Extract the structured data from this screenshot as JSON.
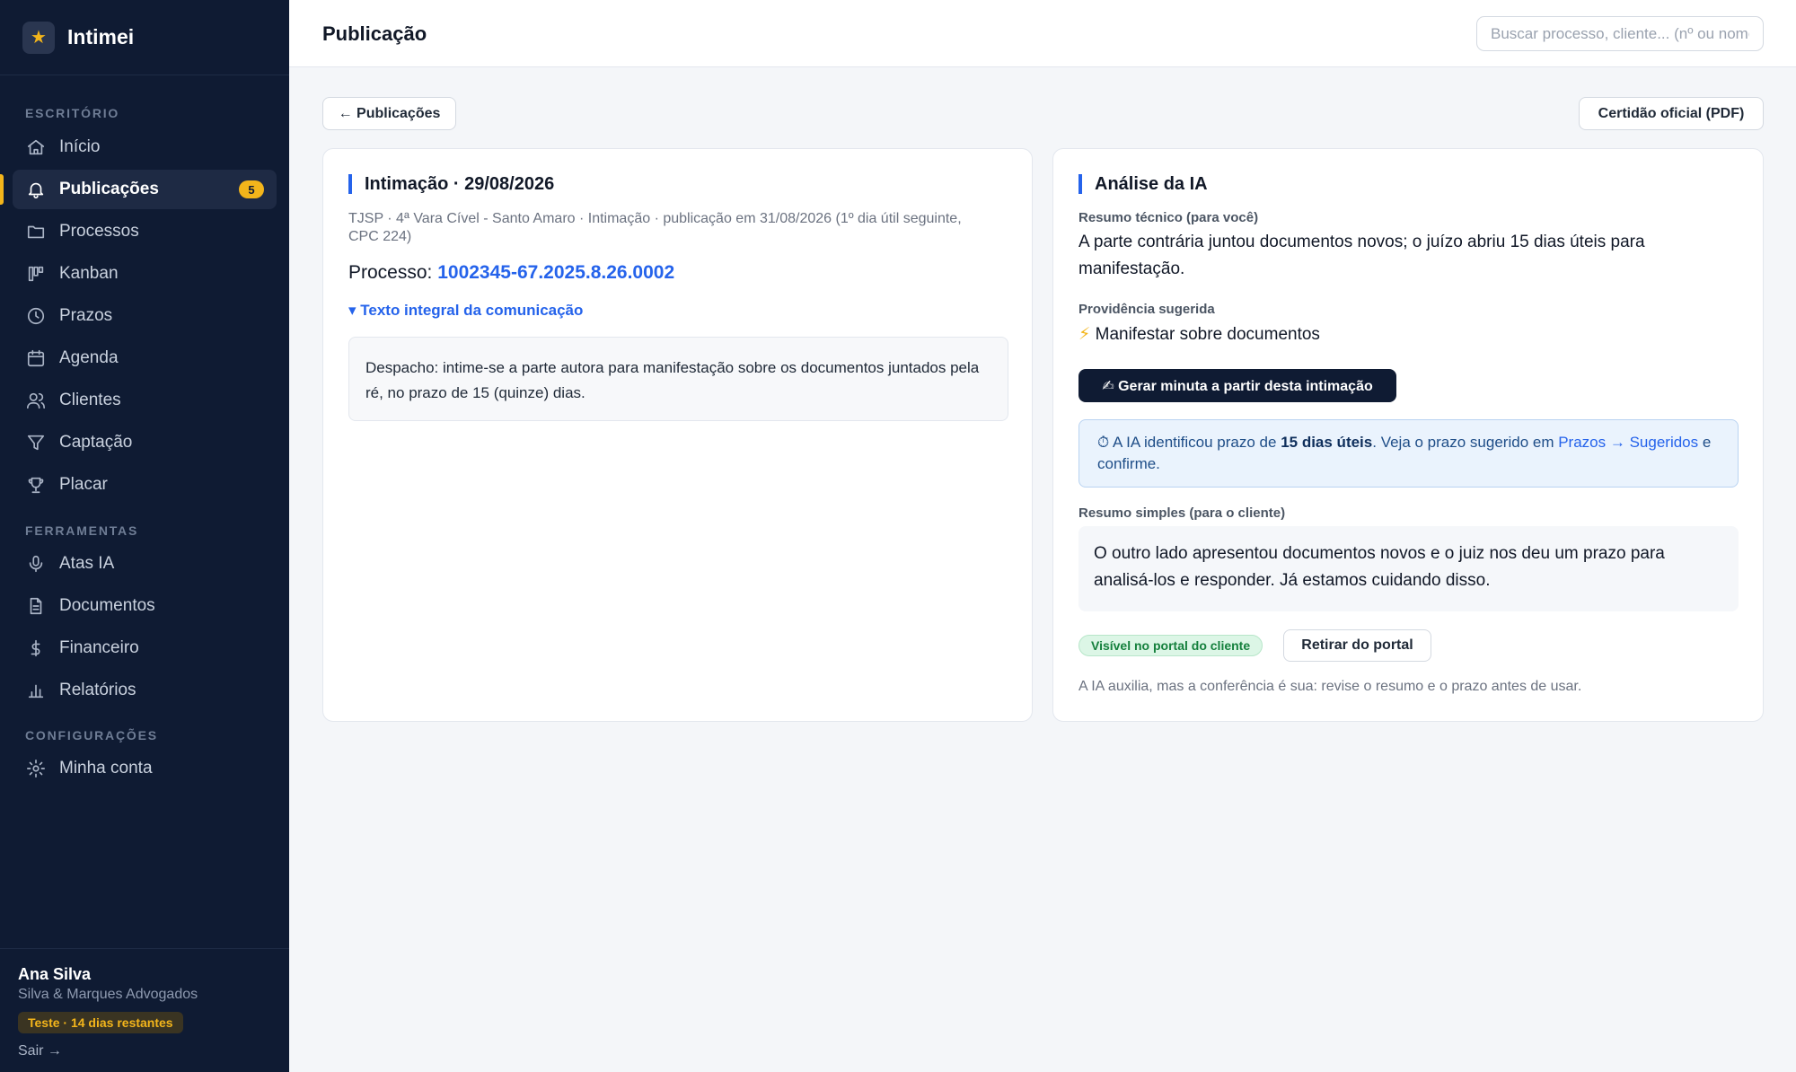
{
  "brand": {
    "logo_glyph": "★",
    "name": "Intimei",
    "accent": "#f3b51b"
  },
  "sidebar": {
    "sections": [
      "ESCRITÓRIO",
      "FERRAMENTAS",
      "CONFIGURAÇÕES"
    ],
    "items": [
      {
        "label": "Início",
        "icon": "home-icon"
      },
      {
        "label": "Publicações",
        "icon": "bell-icon",
        "badge": "5",
        "active": true
      },
      {
        "label": "Processos",
        "icon": "folder-icon"
      },
      {
        "label": "Kanban",
        "icon": "kanban-icon"
      },
      {
        "label": "Prazos",
        "icon": "clock-icon"
      },
      {
        "label": "Agenda",
        "icon": "calendar-icon"
      },
      {
        "label": "Clientes",
        "icon": "users-icon"
      },
      {
        "label": "Captação",
        "icon": "filter-icon"
      },
      {
        "label": "Placar",
        "icon": "trophy-icon"
      },
      {
        "label": "Atas IA",
        "icon": "microphone-icon"
      },
      {
        "label": "Documentos",
        "icon": "document-icon"
      },
      {
        "label": "Financeiro",
        "icon": "dollar-icon"
      },
      {
        "label": "Relatórios",
        "icon": "bar-chart-icon"
      },
      {
        "label": "Minha conta",
        "icon": "gear-icon"
      }
    ],
    "user": {
      "name": "Ana Silva",
      "firm": "Silva & Marques Advogados",
      "trial": "Teste · 14 dias restantes",
      "logout": "Sair →"
    }
  },
  "header": {
    "title": "Publicação",
    "search_placeholder": "Buscar processo, cliente... (nº ou nome)"
  },
  "actions": {
    "back": "← Publicações",
    "certificate": "Certidão oficial (PDF)"
  },
  "publication": {
    "title": "Intimação · 29/08/2026",
    "meta": "TJSP · 4ª Vara Cível - Santo Amaro · Intimação · publicação em 31/08/2026 (1º dia útil seguinte, CPC 224)",
    "process_label": "Processo: ",
    "process_number": "1002345-67.2025.8.26.0002",
    "toggle": "▾ Texto integral da comunicação",
    "full_text": "Despacho: intime-se a parte autora para manifestação sobre os documentos juntados pela ré, no prazo de 15 (quinze) dias."
  },
  "analysis": {
    "title": "Análise da IA",
    "tech_label": "Resumo técnico (para você)",
    "tech_text": "A parte contrária juntou documentos novos; o juízo abriu 15 dias úteis para manifestação.",
    "action_label": "Providência sugerida",
    "action_icon": "⚡",
    "action_text": "Manifestar sobre documentos",
    "draft_button": "✍ Gerar minuta a partir desta intimação",
    "deadline": {
      "icon": "⏱",
      "pre": " A IA identificou prazo de ",
      "bold": "15 dias úteis",
      "mid": ". Veja o prazo sugerido em ",
      "link": "Prazos → Sugeridos",
      "post": " e confirme."
    },
    "simple_label": "Resumo simples (para o cliente)",
    "simple_text": "O outro lado apresentou documentos novos e o juiz nos deu um prazo para analisá-los e responder. Já estamos cuidando disso.",
    "portal_status": "Visível no portal do cliente",
    "portal_button": "Retirar do portal",
    "disclaimer": "A IA auxilia, mas a conferência é sua: revise o resumo e o prazo antes de usar."
  }
}
